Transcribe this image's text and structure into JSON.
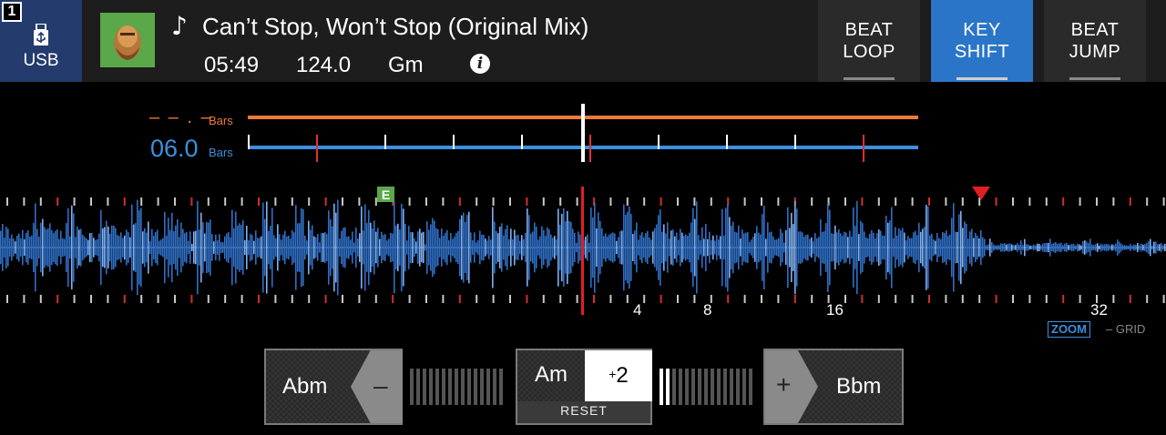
{
  "header": {
    "deck_number": "1",
    "source": "USB",
    "icons": {
      "usb": "usb-icon",
      "note": "music-note-icon",
      "info": "info-icon"
    },
    "track": {
      "note_glyph": "♪",
      "title": "Can’t Stop, Won’t Stop (Original Mix)",
      "time": "05:49",
      "bpm": "124.0",
      "key": "Gm",
      "info_glyph": "i"
    },
    "mode_buttons": [
      {
        "line1": "BEAT",
        "line2": "LOOP",
        "active": false
      },
      {
        "line1": "KEY",
        "line2": "SHIFT",
        "active": true
      },
      {
        "line1": "BEAT",
        "line2": "JUMP",
        "active": false
      }
    ]
  },
  "phrase": {
    "top_value": "– – . –",
    "top_unit": "Bars",
    "bottom_value": "06.0",
    "bottom_unit": "Bars",
    "colors": {
      "top": "#ee7a3a",
      "bottom": "#3d8fe0"
    }
  },
  "waveform": {
    "memory_cue_label": "E",
    "grid_numbers": [
      "4",
      "8",
      "16",
      "32"
    ],
    "zoom_label": "ZOOM",
    "grid_label": "– GRID",
    "colors": {
      "wave": "#2f6fc4",
      "playhead": "#e02020",
      "cue_marker": "#e02020",
      "memory_cue": "#5aa84a"
    }
  },
  "key_controls": {
    "down": {
      "target_key": "Abm",
      "sign": "–"
    },
    "current_key": "Am",
    "shift_sign": "+",
    "shift_value": "2",
    "reset_label": "RESET",
    "up": {
      "sign": "+",
      "target_key": "Bbm"
    }
  }
}
